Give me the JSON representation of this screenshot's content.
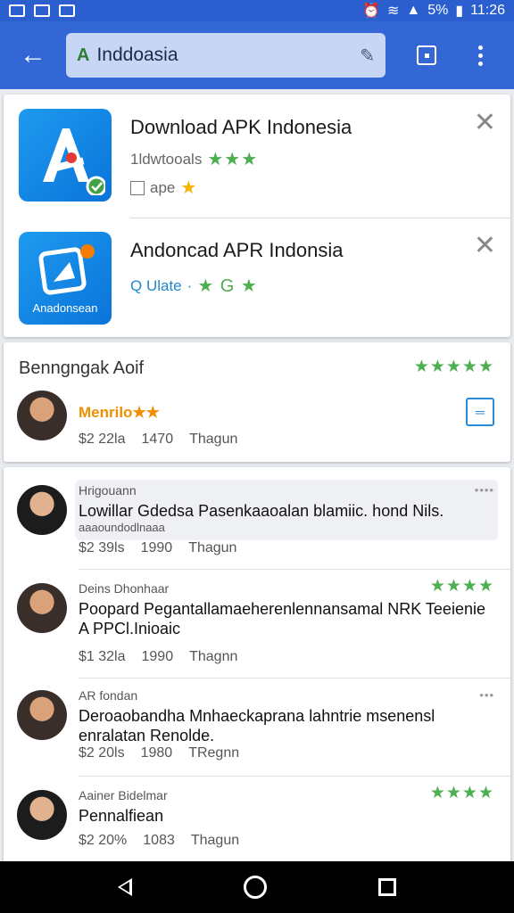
{
  "status": {
    "battery": "5%",
    "time": "11:26"
  },
  "search": {
    "query": "Inddoasia",
    "icon_letter": "A"
  },
  "apps": [
    {
      "title": "Download APK Indonesia",
      "line1": "1ldwtooals",
      "line1_stars": "★★★",
      "line2": "ape",
      "line2_star": "★",
      "close": "✕"
    },
    {
      "title": "Andoncad APR Indonsia",
      "line1": "Q Ulate",
      "line1_stars": "★ G ★",
      "icon_label": "Anadonsean",
      "close": "✕"
    }
  ],
  "featured": {
    "title": "Benngngak Aoif",
    "stars": "★★★★★",
    "name": "Menrilo★★",
    "meta": [
      "$2 22la",
      "1470",
      "Thagun"
    ]
  },
  "reviews": [
    {
      "name": "Hrigouann",
      "text": "Lowillar Gdedsa Pasenkaaoalan blamiic. hond Nils.",
      "subtext": "aaaoundodlnaaa",
      "meta": [
        "$2 39ls",
        "1990",
        "Thagun"
      ],
      "more": "••••"
    },
    {
      "name": "Deins Dhonhaar",
      "text": "Poopard Pegantallamaeherenlennansamal NRK Teeienie A PPCl.Inioaic",
      "meta": [
        "$1 32la",
        "1990",
        "Thagnn"
      ],
      "stars": "★★★★"
    },
    {
      "name": "AR fondan",
      "text": "Deroaobandha Mnhaeckaprana lahntrie msenensl enralatan Renolde.",
      "meta": [
        "$2 20ls",
        "1980",
        "TRegnn"
      ],
      "more": "•••"
    },
    {
      "name": "Aainer Bidelmar",
      "text": "Pennalfiean",
      "meta": [
        "$2 20%",
        "1083",
        "Thagun"
      ],
      "stars": "★★★★"
    }
  ]
}
